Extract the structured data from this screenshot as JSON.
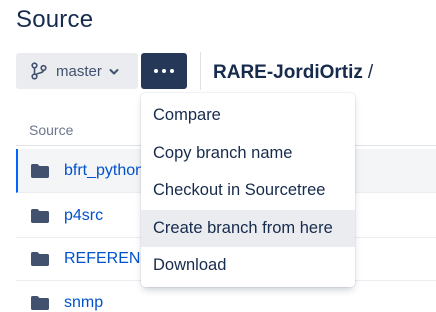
{
  "page": {
    "title": "Source"
  },
  "toolbar": {
    "branch_label": "master",
    "branch_icon": "git-branch-icon",
    "more_icon": "more-horizontal-icon",
    "repo_name": "RARE-JordiOrtiz",
    "path_separator": "/"
  },
  "table": {
    "column_header": "Source",
    "rows": [
      {
        "name": "bfrt_python",
        "type": "folder",
        "selected": true
      },
      {
        "name": "p4src",
        "type": "folder",
        "selected": false
      },
      {
        "name": "REFERENCE",
        "type": "folder",
        "selected": false
      },
      {
        "name": "snmp",
        "type": "folder",
        "selected": false
      }
    ]
  },
  "dropdown": {
    "items": [
      {
        "label": "Compare"
      },
      {
        "label": "Copy branch name"
      },
      {
        "label": "Checkout in Sourcetree"
      },
      {
        "label": "Create branch from here",
        "hovered": true
      },
      {
        "label": "Download"
      }
    ]
  },
  "colors": {
    "link": "#0052cc",
    "text": "#172b4d",
    "primary_button": "#253858",
    "selection_border": "#0065ff"
  }
}
